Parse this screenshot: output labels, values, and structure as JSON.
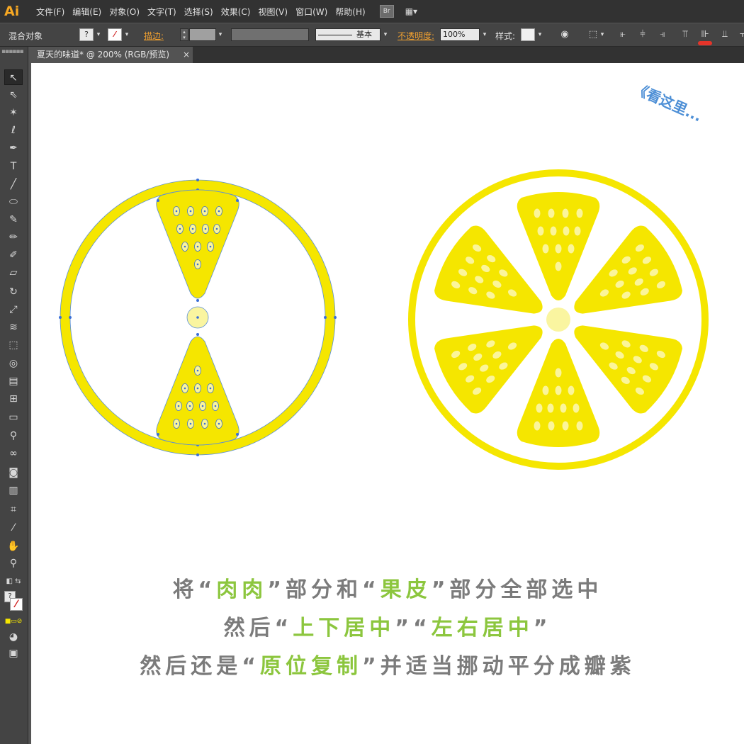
{
  "app": {
    "logo": "Ai"
  },
  "menu": [
    "文件(F)",
    "编辑(E)",
    "对象(O)",
    "文字(T)",
    "选择(S)",
    "效果(C)",
    "视图(V)",
    "窗口(W)",
    "帮助(H)"
  ],
  "menubar": {
    "bridge_label": "Br"
  },
  "control_bar": {
    "selection_label": "混合对象",
    "fill_swatch": "?",
    "stroke_label": "描边:",
    "stroke_profile": "基本",
    "opacity_label": "不透明度:",
    "opacity_value": "100%",
    "style_label": "样式:"
  },
  "document": {
    "tab_title": "夏天的味道* @ 200% (RGB/预览)",
    "tab_close": "×"
  },
  "toolbar": {
    "fill_unknown": "?"
  },
  "canvas": {
    "note": "《看这里...",
    "instructions": {
      "line1": {
        "p1": "将“",
        "h1": "肉肉",
        "p2": "”部分和“",
        "h2": "果皮",
        "p3": "”部分全部选中"
      },
      "line2": {
        "p1": "然后“",
        "h1": "上下居中",
        "p2": "”“",
        "h2": "左右居中",
        "p3": "”"
      },
      "line3": {
        "p1": "然后还是“",
        "h1": "原位复制",
        "p2": "”并适当挪动平分成瓣紫"
      }
    }
  },
  "colors": {
    "lemon": "#f5e600",
    "seed": "#fbf59a",
    "core": "#faf5a0",
    "highlight": "#8cc63e",
    "instruction": "#7b7b7b",
    "note": "#4d8fd6",
    "anchor": "#3a6fd8"
  }
}
